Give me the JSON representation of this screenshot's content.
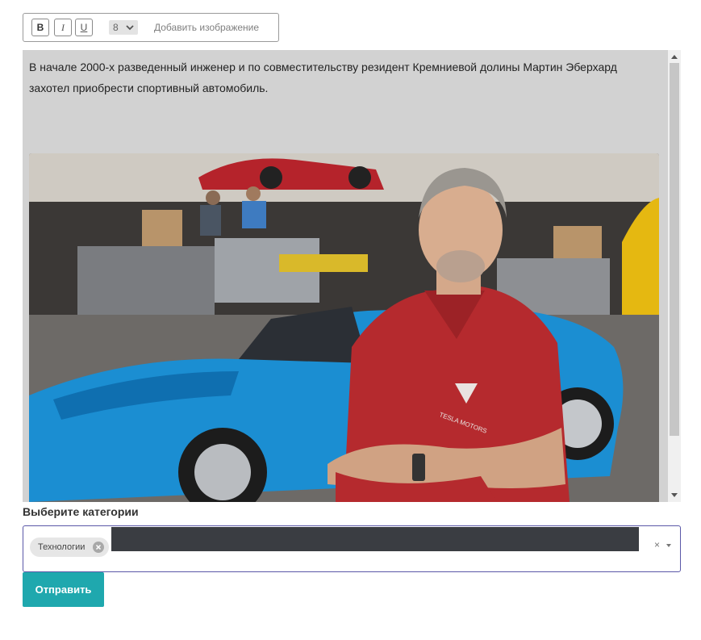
{
  "toolbar": {
    "bold_label": "B",
    "italic_label": "I",
    "underline_label": "U",
    "font_size": "8",
    "add_image_label": "Добавить изображение"
  },
  "editor": {
    "text": "В начале 2000-х разведенный инженер и по совместительству резидент Кремниевой долины Мартин Эберхард захотел приобрести спортивный автомобиль.",
    "image_badge_text": "TESLA MOTORS"
  },
  "category": {
    "label": "Выберите категории",
    "selected_tags": [
      "Технологии"
    ],
    "clear_symbol": "×"
  },
  "form": {
    "submit_label": "Отправить"
  },
  "colors": {
    "accent": "#1fa8ae",
    "select_border": "#5b58a8",
    "editor_bg": "#d2d2d2"
  }
}
